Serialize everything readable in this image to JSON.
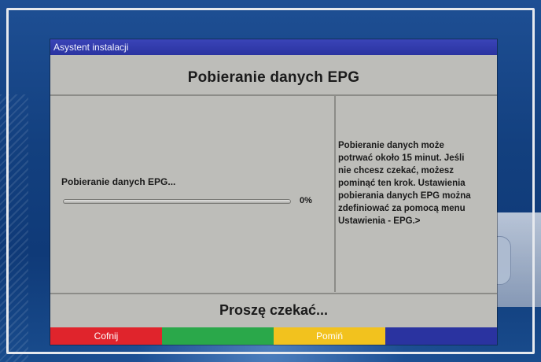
{
  "window_title": "Asystent instalacji",
  "heading": "Pobieranie danych EPG",
  "progress": {
    "label": "Pobieranie danych EPG...",
    "percent_text": "0%",
    "value": 0
  },
  "info_lines": [
    "Pobieranie danych może",
    "potrwać około 15 minut. Jeśli",
    "nie chcesz czekać, możesz",
    "pominąć ten krok. Ustawienia",
    "pobierania danych EPG można",
    "zdefiniować za pomocą menu",
    "Ustawienia - EPG.>"
  ],
  "status": "Proszę czekać...",
  "color_keys": [
    {
      "label": "Cofnij",
      "color": "#e0242c",
      "text_color": "#ffffff"
    },
    {
      "label": "",
      "color": "#2aa84a",
      "text_color": "#ffffff"
    },
    {
      "label": "Pomiń",
      "color": "#f2c21e",
      "text_color": "#ffffff"
    },
    {
      "label": "",
      "color": "#2a33a0",
      "text_color": "#ffffff"
    }
  ]
}
